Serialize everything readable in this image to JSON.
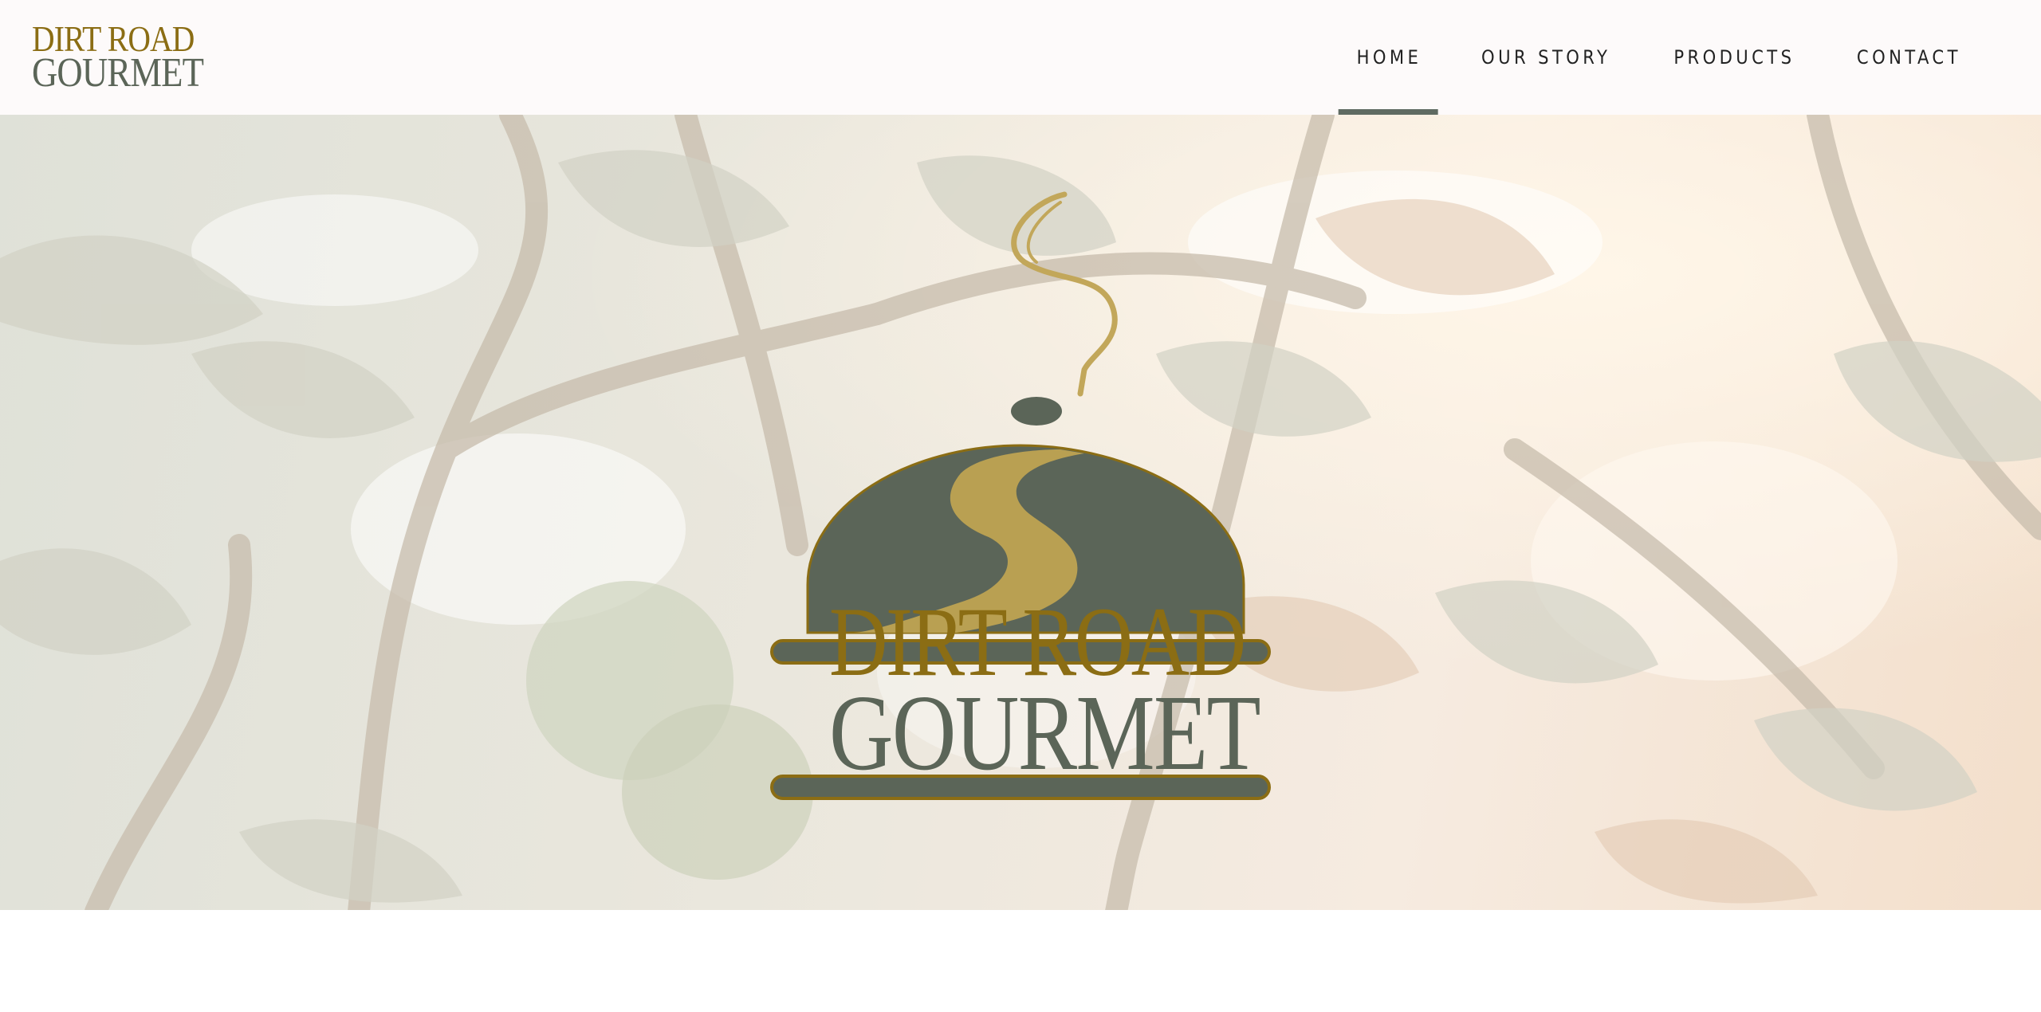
{
  "header": {
    "logo": {
      "line1": "DIRT ROAD",
      "line2": "GOURMET"
    },
    "nav": {
      "items": [
        {
          "label": "HOME",
          "active": true
        },
        {
          "label": "OUR STORY",
          "active": false
        },
        {
          "label": "PRODUCTS",
          "active": false
        },
        {
          "label": "CONTACT",
          "active": false
        }
      ]
    }
  },
  "hero": {
    "logo": {
      "line1": "DIRT ROAD",
      "line2": "GOURMET"
    },
    "background": "tomato-plant-photo"
  },
  "colors": {
    "brand_gold": "#8b6d14",
    "brand_green": "#5b6558",
    "road_gold": "#b9a052",
    "nav_indicator": "#5f6b62"
  }
}
